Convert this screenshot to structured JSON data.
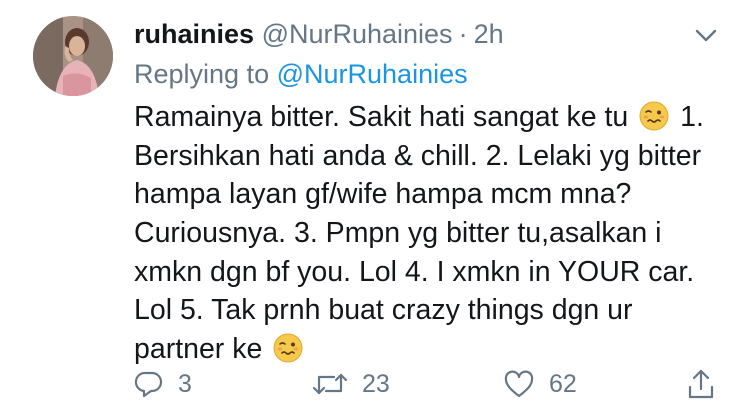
{
  "tweet": {
    "display_name": "ruhainies",
    "handle": "@NurRuhainies",
    "separator": "·",
    "time": "2h",
    "replying_prefix": "Replying to",
    "replying_to": "@NurRuhainies",
    "text_lines": [
      {
        "before": "Ramainya bitter. Sakit hati sangat ke tu",
        "emoji": "woozy-face",
        "after": "1."
      },
      {
        "before": "Bersihkan hati anda & chill. 2. Lelaki yg bitter"
      },
      {
        "before": "hampa layan gf/wife hampa mcm mna?"
      },
      {
        "before": "Curiousnya. 3. Pmpn yg bitter tu,asalkan i"
      },
      {
        "before": "xmkn dgn bf you. Lol 4. I xmkn in YOUR car."
      },
      {
        "before": "Lol 5. Tak prnh buat crazy things dgn ur"
      },
      {
        "before": "partner ke",
        "emoji": "woozy-face"
      }
    ]
  },
  "actions": {
    "reply_count": "3",
    "retweet_count": "23",
    "like_count": "62"
  },
  "icons": {
    "menu": "chevron-down-icon",
    "reply": "reply-bubble-icon",
    "retweet": "retweet-icon",
    "like": "heart-icon",
    "share": "share-icon"
  },
  "colors": {
    "link": "#1b95e0",
    "muted": "#657786",
    "text": "#14171a"
  }
}
